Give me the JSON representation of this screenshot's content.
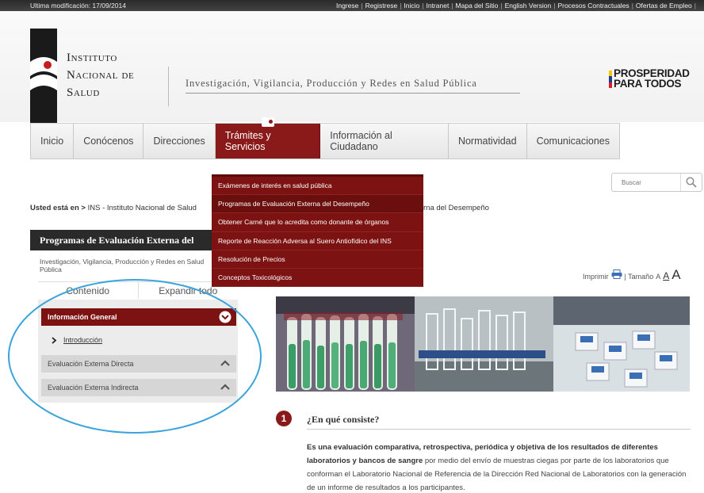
{
  "topbar": {
    "last_modified": "Ultima modificación: 17/09/2014",
    "links": [
      "Ingrese",
      "Registrese",
      "Inicio",
      "Intranet",
      "Mapa del Sitio",
      "English Version",
      "Procesos Contractuales",
      "Ofertas de Empleo"
    ]
  },
  "header": {
    "logo_line1": "Instituto",
    "logo_line2": "Nacional de",
    "logo_line3": "Salud",
    "tagline": "Investigación, Vigilancia, Producción y Redes en Salud Pública",
    "prosperidad_line1": "PROSPERIDAD",
    "prosperidad_line2": "PARA TODOS"
  },
  "nav": {
    "items": [
      "Inicio",
      "Conócenos",
      "Direcciones",
      "Trámites y Servicios",
      "Información al Ciudadano",
      "Normatividad",
      "Comunicaciones"
    ],
    "active_index": 3
  },
  "dropdown": {
    "items": [
      "Exámenes de interés en salud pública",
      "Programas de Evaluación Externa del Desempeño",
      "Obtener Carné que lo acredita como donante de órganos",
      "Reporte de Reacción Adversa al Suero Antiofídico del INS",
      "Resolución de Precios",
      "Conceptos Toxicológicos"
    ]
  },
  "search": {
    "placeholder": "Buscar"
  },
  "breadcrumb": {
    "prefix": "Usted está en >",
    "trail": "INS - Instituto Nacional de Salud",
    "tail": "rna del Desempeño"
  },
  "left_panel": {
    "title": "Programas de Evaluación Externa del",
    "subtitle": "Investigación, Vigilancia, Producción y Redes en Salud Pública",
    "contents_label": "Contenido",
    "expand_label": "Expandir todo",
    "active_section": "Información General",
    "active_sub": "Introducción",
    "sections": [
      "Evaluación Externa Directa",
      "Evaluación Externa Indirecta"
    ]
  },
  "tools": {
    "print": "Imprimir",
    "size": "| Tamaño",
    "a_small": "A",
    "a_med": "A",
    "a_large": "A"
  },
  "section": {
    "number": "1",
    "title": "¿En qué consiste?",
    "body_bold": "Es una evaluación comparativa, retrospectiva, periódica y objetiva de los resultados de diferentes laboratorios y bancos de sangre",
    "body_rest": " por medio del envío de muestras ciegas por parte de los laboratorios que conforman el Laboratorio Nacional de Referencia de la Dirección Red Nacional de Laboratorios con la generación de un informe de resultados a los participantes."
  },
  "colors": {
    "brand_red": "#8a1a1a",
    "dropdown_red": "#7d1212",
    "annotation_blue": "#3aa3db"
  }
}
